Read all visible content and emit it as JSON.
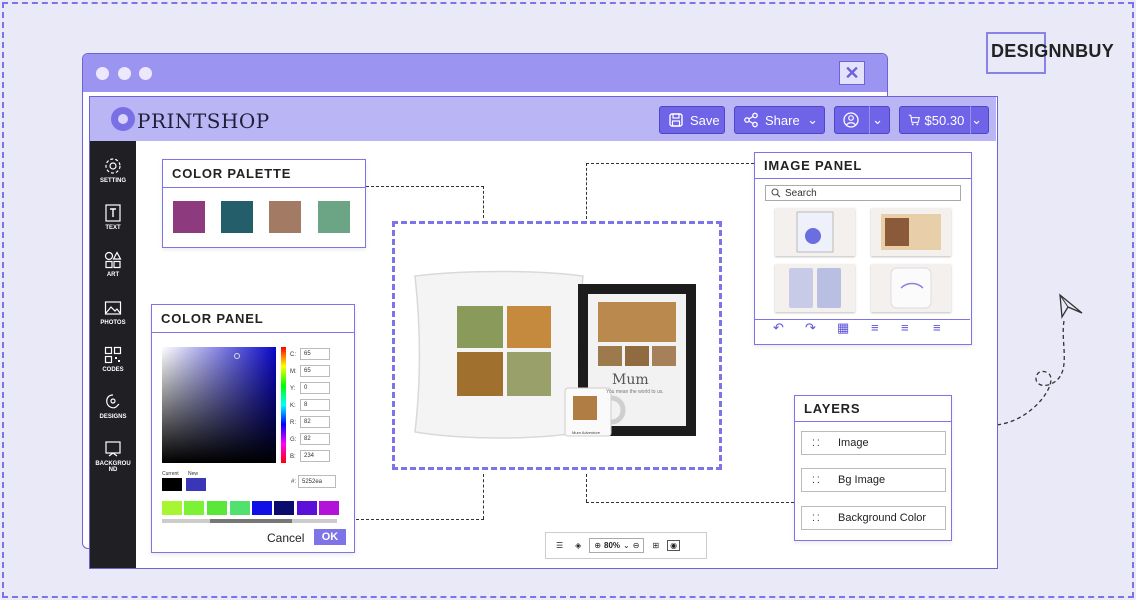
{
  "brand": {
    "name": "DESIGNNBUY"
  },
  "app": {
    "logo_text": "PRINTSHOP",
    "header": {
      "save_label": "Save",
      "share_label": "Share",
      "price_label": "$50.30"
    },
    "sidebar": [
      {
        "label": "SETTING",
        "icon": "gear-icon"
      },
      {
        "label": "TEXT",
        "icon": "text-icon"
      },
      {
        "label": "ART",
        "icon": "art-icon"
      },
      {
        "label": "PHOTOS",
        "icon": "photos-icon"
      },
      {
        "label": "CODES",
        "icon": "qr-code-icon"
      },
      {
        "label": "DESIGNS",
        "icon": "designs-icon"
      },
      {
        "label": "BACKGROU ND",
        "icon": "background-icon"
      }
    ]
  },
  "color_palette": {
    "title": "COLOR PALETTE",
    "swatches": [
      "#8d3a7e",
      "#255e6b",
      "#a37a63",
      "#6ba585"
    ]
  },
  "color_panel": {
    "title": "COLOR PANEL",
    "cmyk": [
      {
        "label": "C:",
        "value": "65"
      },
      {
        "label": "M:",
        "value": "65"
      },
      {
        "label": "Y:",
        "value": "0"
      },
      {
        "label": "K:",
        "value": "8"
      },
      {
        "label": "R:",
        "value": "82"
      },
      {
        "label": "G:",
        "value": "82"
      },
      {
        "label": "B:",
        "value": "234"
      }
    ],
    "current_label": "Current",
    "new_label": "New",
    "hex_label": "#:",
    "hex_value": "5252ea",
    "swatches": [
      "#a8f534",
      "#7bf236",
      "#5be63a",
      "#52e06f",
      "#1010e6",
      "#0b0b6e",
      "#5a10d8",
      "#b312d8"
    ],
    "cancel_label": "Cancel",
    "ok_label": "OK"
  },
  "image_panel": {
    "title": "IMAGE PANEL",
    "search_placeholder": "Search"
  },
  "layers": {
    "title": "LAYERS",
    "items": [
      "Image",
      "Bg Image",
      "Background Color"
    ]
  },
  "canvas": {
    "frame_text": "Mum",
    "frame_subtext": "You mean the world to us.",
    "mug_text": "Mum Adventure"
  },
  "toolbar": {
    "zoom_label": "80%"
  },
  "colors": {
    "accent": "#7d74e8",
    "header_bg": "#bab6f5",
    "sidebar_bg": "#1f1f24"
  }
}
